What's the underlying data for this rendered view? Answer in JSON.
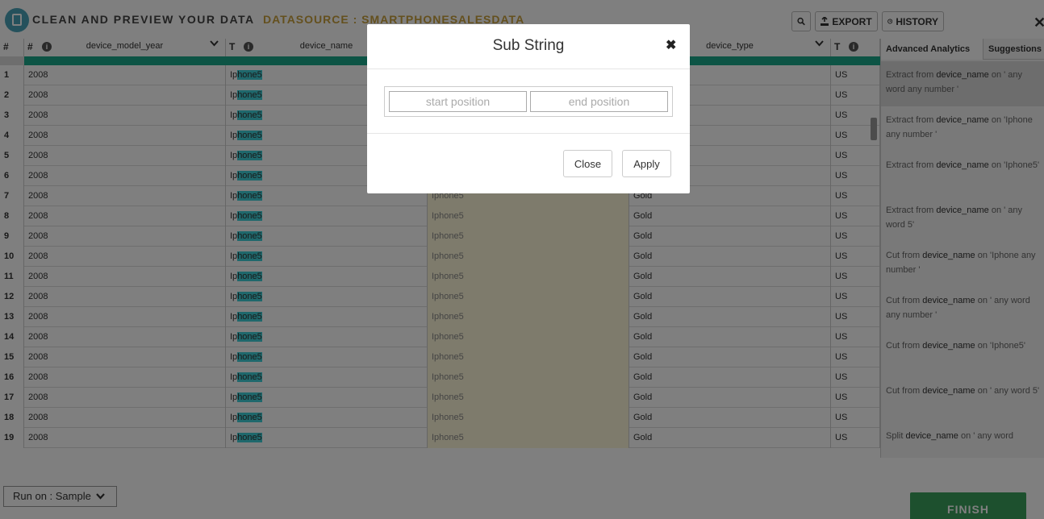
{
  "header": {
    "app_title": "CLEAN AND PREVIEW YOUR DATA",
    "datasource": "DATASOURCE : SMARTPHONESALESDATA",
    "export_label": "EXPORT",
    "history_label": "HISTORY"
  },
  "grid": {
    "index_header": "#",
    "columns": [
      {
        "type": "#",
        "name": "device_model_year"
      },
      {
        "type": "T",
        "name": "device_name"
      },
      {
        "type": "",
        "name": ""
      },
      {
        "type": "",
        "name": "device_type"
      },
      {
        "type": "T",
        "name": ""
      }
    ],
    "rows": [
      {
        "idx": "1",
        "year": "2008",
        "name_pre": "Ip",
        "name_hl": "hone5",
        "extracted": "",
        "type": "",
        "country": "US"
      },
      {
        "idx": "2",
        "year": "2008",
        "name_pre": "Ip",
        "name_hl": "hone5",
        "extracted": "",
        "type": "",
        "country": "US"
      },
      {
        "idx": "3",
        "year": "2008",
        "name_pre": "Ip",
        "name_hl": "hone5",
        "extracted": "",
        "type": "",
        "country": "US"
      },
      {
        "idx": "4",
        "year": "2008",
        "name_pre": "Ip",
        "name_hl": "hone5",
        "extracted": "",
        "type": "",
        "country": "US"
      },
      {
        "idx": "5",
        "year": "2008",
        "name_pre": "Ip",
        "name_hl": "hone5",
        "extracted": "",
        "type": "",
        "country": "US"
      },
      {
        "idx": "6",
        "year": "2008",
        "name_pre": "Ip",
        "name_hl": "hone5",
        "extracted": "",
        "type": "",
        "country": "US"
      },
      {
        "idx": "7",
        "year": "2008",
        "name_pre": "Ip",
        "name_hl": "hone5",
        "extracted": "Iphone5",
        "type": "Gold",
        "country": "US"
      },
      {
        "idx": "8",
        "year": "2008",
        "name_pre": "Ip",
        "name_hl": "hone5",
        "extracted": "Iphone5",
        "type": "Gold",
        "country": "US"
      },
      {
        "idx": "9",
        "year": "2008",
        "name_pre": "Ip",
        "name_hl": "hone5",
        "extracted": "Iphone5",
        "type": "Gold",
        "country": "US"
      },
      {
        "idx": "10",
        "year": "2008",
        "name_pre": "Ip",
        "name_hl": "hone5",
        "extracted": "Iphone5",
        "type": "Gold",
        "country": "US"
      },
      {
        "idx": "11",
        "year": "2008",
        "name_pre": "Ip",
        "name_hl": "hone5",
        "extracted": "Iphone5",
        "type": "Gold",
        "country": "US"
      },
      {
        "idx": "12",
        "year": "2008",
        "name_pre": "Ip",
        "name_hl": "hone5",
        "extracted": "Iphone5",
        "type": "Gold",
        "country": "US"
      },
      {
        "idx": "13",
        "year": "2008",
        "name_pre": "Ip",
        "name_hl": "hone5",
        "extracted": "Iphone5",
        "type": "Gold",
        "country": "US"
      },
      {
        "idx": "14",
        "year": "2008",
        "name_pre": "Ip",
        "name_hl": "hone5",
        "extracted": "Iphone5",
        "type": "Gold",
        "country": "US"
      },
      {
        "idx": "15",
        "year": "2008",
        "name_pre": "Ip",
        "name_hl": "hone5",
        "extracted": "Iphone5",
        "type": "Gold",
        "country": "US"
      },
      {
        "idx": "16",
        "year": "2008",
        "name_pre": "Ip",
        "name_hl": "hone5",
        "extracted": "Iphone5",
        "type": "Gold",
        "country": "US"
      },
      {
        "idx": "17",
        "year": "2008",
        "name_pre": "Ip",
        "name_hl": "hone5",
        "extracted": "Iphone5",
        "type": "Gold",
        "country": "US"
      },
      {
        "idx": "18",
        "year": "2008",
        "name_pre": "Ip",
        "name_hl": "hone5",
        "extracted": "Iphone5",
        "type": "Gold",
        "country": "US"
      },
      {
        "idx": "19",
        "year": "2008",
        "name_pre": "Ip",
        "name_hl": "hone5",
        "extracted": "Iphone5",
        "type": "Gold",
        "country": "US"
      }
    ]
  },
  "panel": {
    "tab_analytics": "Advanced Analytics",
    "tab_suggestions": "Suggestions",
    "suggestions": [
      {
        "verb": "Extract from ",
        "field": "device_name",
        "rest": " on ' any word any number '"
      },
      {
        "verb": "Extract from ",
        "field": "device_name",
        "rest": " on 'Iphone any number '"
      },
      {
        "verb": "Extract from ",
        "field": "device_name",
        "rest": " on 'Iphone5'"
      },
      {
        "verb": "Extract from ",
        "field": "device_name",
        "rest": " on ' any word 5'"
      },
      {
        "verb": "Cut from ",
        "field": "device_name",
        "rest": " on 'Iphone any number '"
      },
      {
        "verb": "Cut from ",
        "field": "device_name",
        "rest": " on ' any word any number '"
      },
      {
        "verb": "Cut from ",
        "field": "device_name",
        "rest": " on 'Iphone5'"
      },
      {
        "verb": "Cut from ",
        "field": "device_name",
        "rest": " on ' any word 5'"
      },
      {
        "verb": "Split ",
        "field": "device_name",
        "rest": " on ' any word"
      }
    ]
  },
  "footer": {
    "run_on": "Run on : Sample",
    "finish": "FINISH"
  },
  "modal": {
    "title": "Sub String",
    "start_placeholder": "start position",
    "end_placeholder": "end position",
    "close_label": "Close",
    "apply_label": "Apply"
  },
  "colors": {
    "accent_teal": "#1aa98a",
    "highlight": "#3fd0d8",
    "datasource_gold": "#c9a13d",
    "finish_green": "#3aa05d"
  }
}
